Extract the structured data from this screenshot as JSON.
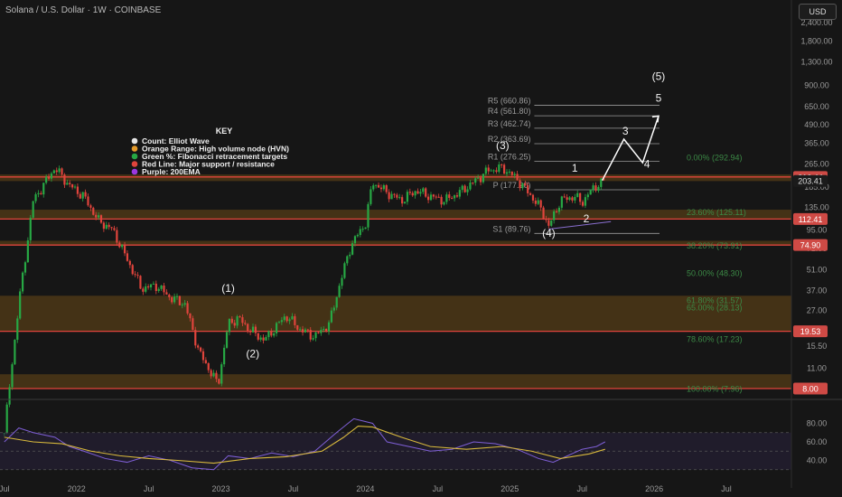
{
  "header": {
    "title": "Solana / U.S. Dollar · 1W · COINBASE",
    "currency_button": "USD"
  },
  "key": {
    "heading": "KEY",
    "items": [
      {
        "label": "Count: Elliot Wave",
        "color": "#e6e6e6"
      },
      {
        "label": "Orange Range: High volume node (HVN)",
        "color": "#e39a2b"
      },
      {
        "label": "Green %: Fibonacci retracement targets",
        "color": "#27a844"
      },
      {
        "label": "Red Line: Major support / resistance",
        "color": "#e0443c"
      },
      {
        "label": "Purple: 200EMA",
        "color": "#9b37e0"
      }
    ]
  },
  "chart_data": {
    "type": "candlestick",
    "y_scale": "log",
    "grid": false,
    "x_ticks": [
      "Jul",
      "2022",
      "Jul",
      "2023",
      "Jul",
      "2024",
      "Jul",
      "2025",
      "Jul",
      "2026",
      "Jul"
    ],
    "price_axis_ticks": [
      "2,400.00",
      "1,800.00",
      "1,300.00",
      "900.00",
      "650.00",
      "490.00",
      "365.00",
      "265.00",
      "185.00",
      "135.00",
      "95.00",
      "71.00",
      "51.00",
      "37.00",
      "27.00",
      "15.50",
      "11.00"
    ],
    "price_labels": [
      {
        "value": 216.44,
        "text": "216.44",
        "color": "#cf4a45"
      },
      {
        "value": 203.41,
        "text": "203.41",
        "color": "#1b1b1b"
      },
      {
        "value": 112.41,
        "text": "112.41",
        "color": "#cf4a45"
      },
      {
        "value": 74.9,
        "text": "74.90",
        "color": "#cf4a45"
      },
      {
        "value": 19.53,
        "text": "19.53",
        "color": "#cf4a45"
      },
      {
        "value": 8.0,
        "text": "8.00",
        "color": "#cf4a45"
      }
    ],
    "hvn_ranges": [
      {
        "low": 74.9,
        "high": 80
      },
      {
        "low": 112,
        "high": 130
      },
      {
        "low": 203,
        "high": 225
      },
      {
        "low": 19.5,
        "high": 34
      },
      {
        "low": 8,
        "high": 10
      }
    ],
    "red_lines": [
      216.44,
      112.41,
      74.9,
      19.53,
      8.0
    ],
    "fib_levels": [
      {
        "text": "0.00% (292.94)",
        "value": 292.94
      },
      {
        "text": "23.60% (125.11)",
        "value": 125.11
      },
      {
        "text": "38.20% (73.91)",
        "value": 73.91
      },
      {
        "text": "50.00% (48.30)",
        "value": 48.3
      },
      {
        "text": "61.80% (31.57)",
        "value": 31.57
      },
      {
        "text": "65.00% (28.13)",
        "value": 28.13
      },
      {
        "text": "78.60% (17.23)",
        "value": 17.23
      },
      {
        "text": "100.00% (7.96)",
        "value": 7.96
      }
    ],
    "pivots": [
      {
        "text": "R5 (660.86)",
        "value": 660.86
      },
      {
        "text": "R4 (561.80)",
        "value": 561.8
      },
      {
        "text": "R3 (462.74)",
        "value": 462.74
      },
      {
        "text": "R2 (363.69)",
        "value": 363.69
      },
      {
        "text": "R1 (276.25)",
        "value": 276.25
      },
      {
        "text": "P (177.20)",
        "value": 177.2
      },
      {
        "text": "S1 (89.76)",
        "value": 89.76
      }
    ],
    "wave_labels": [
      {
        "text": "(1)",
        "x": 2023.05,
        "y": 36
      },
      {
        "text": "(2)",
        "x": 2023.22,
        "y": 13
      },
      {
        "text": "(3)",
        "x": 2024.95,
        "y": 335
      },
      {
        "text": "(4)",
        "x": 2025.27,
        "y": 85
      },
      {
        "text": "(5)",
        "x": 2026.03,
        "y": 980
      },
      {
        "text": "1",
        "x": 2025.45,
        "y": 235
      },
      {
        "text": "2",
        "x": 2025.53,
        "y": 107
      },
      {
        "text": "3",
        "x": 2025.8,
        "y": 420
      },
      {
        "text": "4",
        "x": 2025.95,
        "y": 250
      },
      {
        "text": "5",
        "x": 2026.03,
        "y": 700
      }
    ],
    "projection": [
      [
        2025.64,
        205
      ],
      [
        2025.79,
        390
      ],
      [
        2025.92,
        270
      ],
      [
        2026.03,
        560
      ]
    ],
    "price_path": [
      [
        2021.5,
        4
      ],
      [
        2021.6,
        30
      ],
      [
        2021.7,
        150
      ],
      [
        2021.85,
        250
      ],
      [
        2021.95,
        190
      ],
      [
        2022.05,
        160
      ],
      [
        2022.15,
        110
      ],
      [
        2022.25,
        95
      ],
      [
        2022.35,
        60
      ],
      [
        2022.45,
        38
      ],
      [
        2022.55,
        40
      ],
      [
        2022.65,
        33
      ],
      [
        2022.75,
        30
      ],
      [
        2022.85,
        14
      ],
      [
        2022.98,
        8.5
      ],
      [
        2023.05,
        22
      ],
      [
        2023.12,
        24
      ],
      [
        2023.2,
        20
      ],
      [
        2023.3,
        17
      ],
      [
        2023.45,
        25
      ],
      [
        2023.55,
        20
      ],
      [
        2023.65,
        18
      ],
      [
        2023.75,
        22
      ],
      [
        2023.82,
        40
      ],
      [
        2023.9,
        75
      ],
      [
        2024.0,
        105
      ],
      [
        2024.05,
        200
      ],
      [
        2024.15,
        170
      ],
      [
        2024.25,
        150
      ],
      [
        2024.35,
        175
      ],
      [
        2024.45,
        160
      ],
      [
        2024.55,
        150
      ],
      [
        2024.65,
        170
      ],
      [
        2024.75,
        200
      ],
      [
        2024.85,
        240
      ],
      [
        2024.95,
        250
      ],
      [
        2025.05,
        210
      ],
      [
        2025.15,
        160
      ],
      [
        2025.22,
        130
      ],
      [
        2025.27,
        100
      ],
      [
        2025.35,
        150
      ],
      [
        2025.45,
        160
      ],
      [
        2025.5,
        145
      ],
      [
        2025.55,
        170
      ],
      [
        2025.6,
        190
      ],
      [
        2025.65,
        203
      ]
    ],
    "rsi": {
      "ticks": [
        80,
        60,
        40
      ],
      "rsi_path": [
        [
          2021.5,
          60
        ],
        [
          2021.6,
          75
        ],
        [
          2021.7,
          70
        ],
        [
          2021.85,
          65
        ],
        [
          2021.95,
          55
        ],
        [
          2022.05,
          50
        ],
        [
          2022.2,
          42
        ],
        [
          2022.35,
          38
        ],
        [
          2022.5,
          45
        ],
        [
          2022.65,
          40
        ],
        [
          2022.8,
          32
        ],
        [
          2022.95,
          30
        ],
        [
          2023.05,
          45
        ],
        [
          2023.2,
          42
        ],
        [
          2023.35,
          48
        ],
        [
          2023.5,
          44
        ],
        [
          2023.65,
          50
        ],
        [
          2023.8,
          70
        ],
        [
          2023.92,
          85
        ],
        [
          2024.05,
          80
        ],
        [
          2024.15,
          60
        ],
        [
          2024.3,
          55
        ],
        [
          2024.45,
          50
        ],
        [
          2024.6,
          52
        ],
        [
          2024.75,
          60
        ],
        [
          2024.9,
          58
        ],
        [
          2025.05,
          52
        ],
        [
          2025.2,
          42
        ],
        [
          2025.3,
          38
        ],
        [
          2025.4,
          45
        ],
        [
          2025.5,
          52
        ],
        [
          2025.6,
          55
        ],
        [
          2025.66,
          60
        ]
      ],
      "ma_path": [
        [
          2021.5,
          65
        ],
        [
          2021.7,
          60
        ],
        [
          2021.9,
          58
        ],
        [
          2022.1,
          50
        ],
        [
          2022.3,
          45
        ],
        [
          2022.5,
          42
        ],
        [
          2022.7,
          40
        ],
        [
          2022.95,
          37
        ],
        [
          2023.2,
          42
        ],
        [
          2023.45,
          44
        ],
        [
          2023.7,
          50
        ],
        [
          2023.85,
          65
        ],
        [
          2023.95,
          77
        ],
        [
          2024.05,
          76
        ],
        [
          2024.25,
          65
        ],
        [
          2024.45,
          55
        ],
        [
          2024.7,
          52
        ],
        [
          2024.95,
          55
        ],
        [
          2025.15,
          50
        ],
        [
          2025.35,
          42
        ],
        [
          2025.55,
          47
        ],
        [
          2025.66,
          52
        ]
      ]
    }
  }
}
